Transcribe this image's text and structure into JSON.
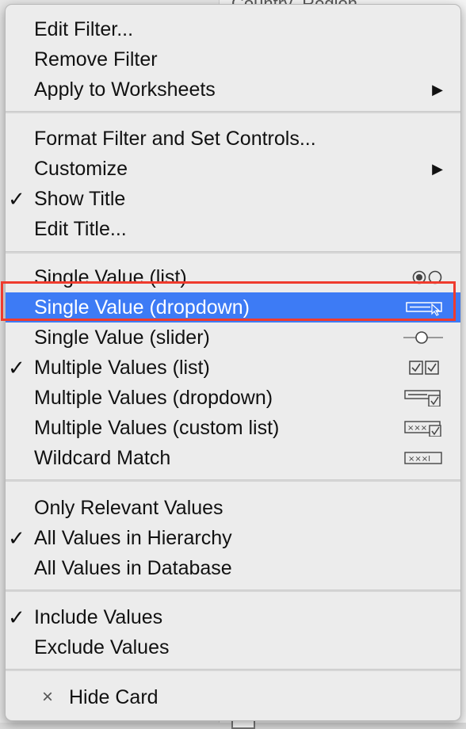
{
  "background": {
    "field_text": "Country_Region"
  },
  "menu": {
    "group1": [
      {
        "label": "Edit Filter...",
        "checked": false,
        "submenu": false
      },
      {
        "label": "Remove Filter",
        "checked": false,
        "submenu": false
      },
      {
        "label": "Apply to Worksheets",
        "checked": false,
        "submenu": true
      }
    ],
    "group2": [
      {
        "label": "Format Filter and Set Controls...",
        "checked": false,
        "submenu": false
      },
      {
        "label": "Customize",
        "checked": false,
        "submenu": true
      },
      {
        "label": "Show Title",
        "checked": true,
        "submenu": false
      },
      {
        "label": "Edit Title...",
        "checked": false,
        "submenu": false
      }
    ],
    "group3": [
      {
        "label": "Single Value (list)",
        "checked": false,
        "icon": "radio-pair-icon"
      },
      {
        "label": "Single Value (dropdown)",
        "checked": false,
        "icon": "dropdown-icon",
        "highlighted": true
      },
      {
        "label": "Single Value (slider)",
        "checked": false,
        "icon": "slider-icon"
      },
      {
        "label": "Multiple Values (list)",
        "checked": true,
        "icon": "checkbox-pair-icon"
      },
      {
        "label": "Multiple Values (dropdown)",
        "checked": false,
        "icon": "dropdown-check-icon"
      },
      {
        "label": "Multiple Values (custom list)",
        "checked": false,
        "icon": "custom-list-icon"
      },
      {
        "label": "Wildcard Match",
        "checked": false,
        "icon": "wildcard-icon"
      }
    ],
    "group4": [
      {
        "label": "Only Relevant Values",
        "checked": false
      },
      {
        "label": "All Values in Hierarchy",
        "checked": true
      },
      {
        "label": "All Values in Database",
        "checked": false
      }
    ],
    "group5": [
      {
        "label": "Include Values",
        "checked": true
      },
      {
        "label": "Exclude Values",
        "checked": false
      }
    ],
    "hide_card": {
      "label": "Hide Card",
      "icon_glyph": "×"
    },
    "check_glyph": "✓",
    "arrow_glyph": "▶",
    "highlight_color": "#3d7bf5",
    "outline_color": "#ef3b2d",
    "icon_text": {
      "custom_list": "×××",
      "wildcard": "×××I"
    }
  }
}
